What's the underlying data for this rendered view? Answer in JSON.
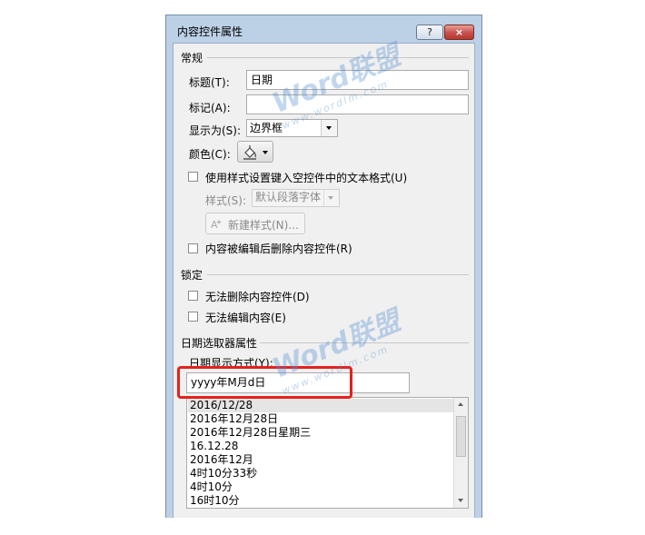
{
  "dialog": {
    "title": "内容控件属性",
    "help_label": "?",
    "close_label": "×"
  },
  "general": {
    "section_label": "常规",
    "title_label": "标题(T):",
    "title_value": "日期",
    "tag_label": "标记(A):",
    "tag_value": "",
    "show_as_label": "显示为(S):",
    "show_as_value": "边界框",
    "color_label": "颜色(C):",
    "use_style_label": "使用样式设置键入空控件中的文本格式(U)",
    "style_label": "样式(S):",
    "style_value": "默认段落字体",
    "new_style_label": "新建样式(N)...",
    "remove_when_edited_label": "内容被编辑后删除内容控件(R)"
  },
  "locking": {
    "section_label": "锁定",
    "cannot_delete_label": "无法删除内容控件(D)",
    "cannot_edit_label": "无法编辑内容(E)"
  },
  "date_picker": {
    "section_label": "日期选取器属性",
    "format_label": "日期显示方式(Y):",
    "format_value": "yyyy年M月d日",
    "formats": [
      "2016/12/28",
      "2016年12月28日",
      "2016年12月28日星期三",
      "16.12.28",
      "2016年12月",
      "4时10分33秒",
      "4时10分",
      "16时10分"
    ]
  },
  "watermark": {
    "brand": "Word联盟",
    "url": "www.wordlm.com"
  },
  "colors": {
    "highlight_border": "#e5211c",
    "frame": "#bcd0e6"
  }
}
